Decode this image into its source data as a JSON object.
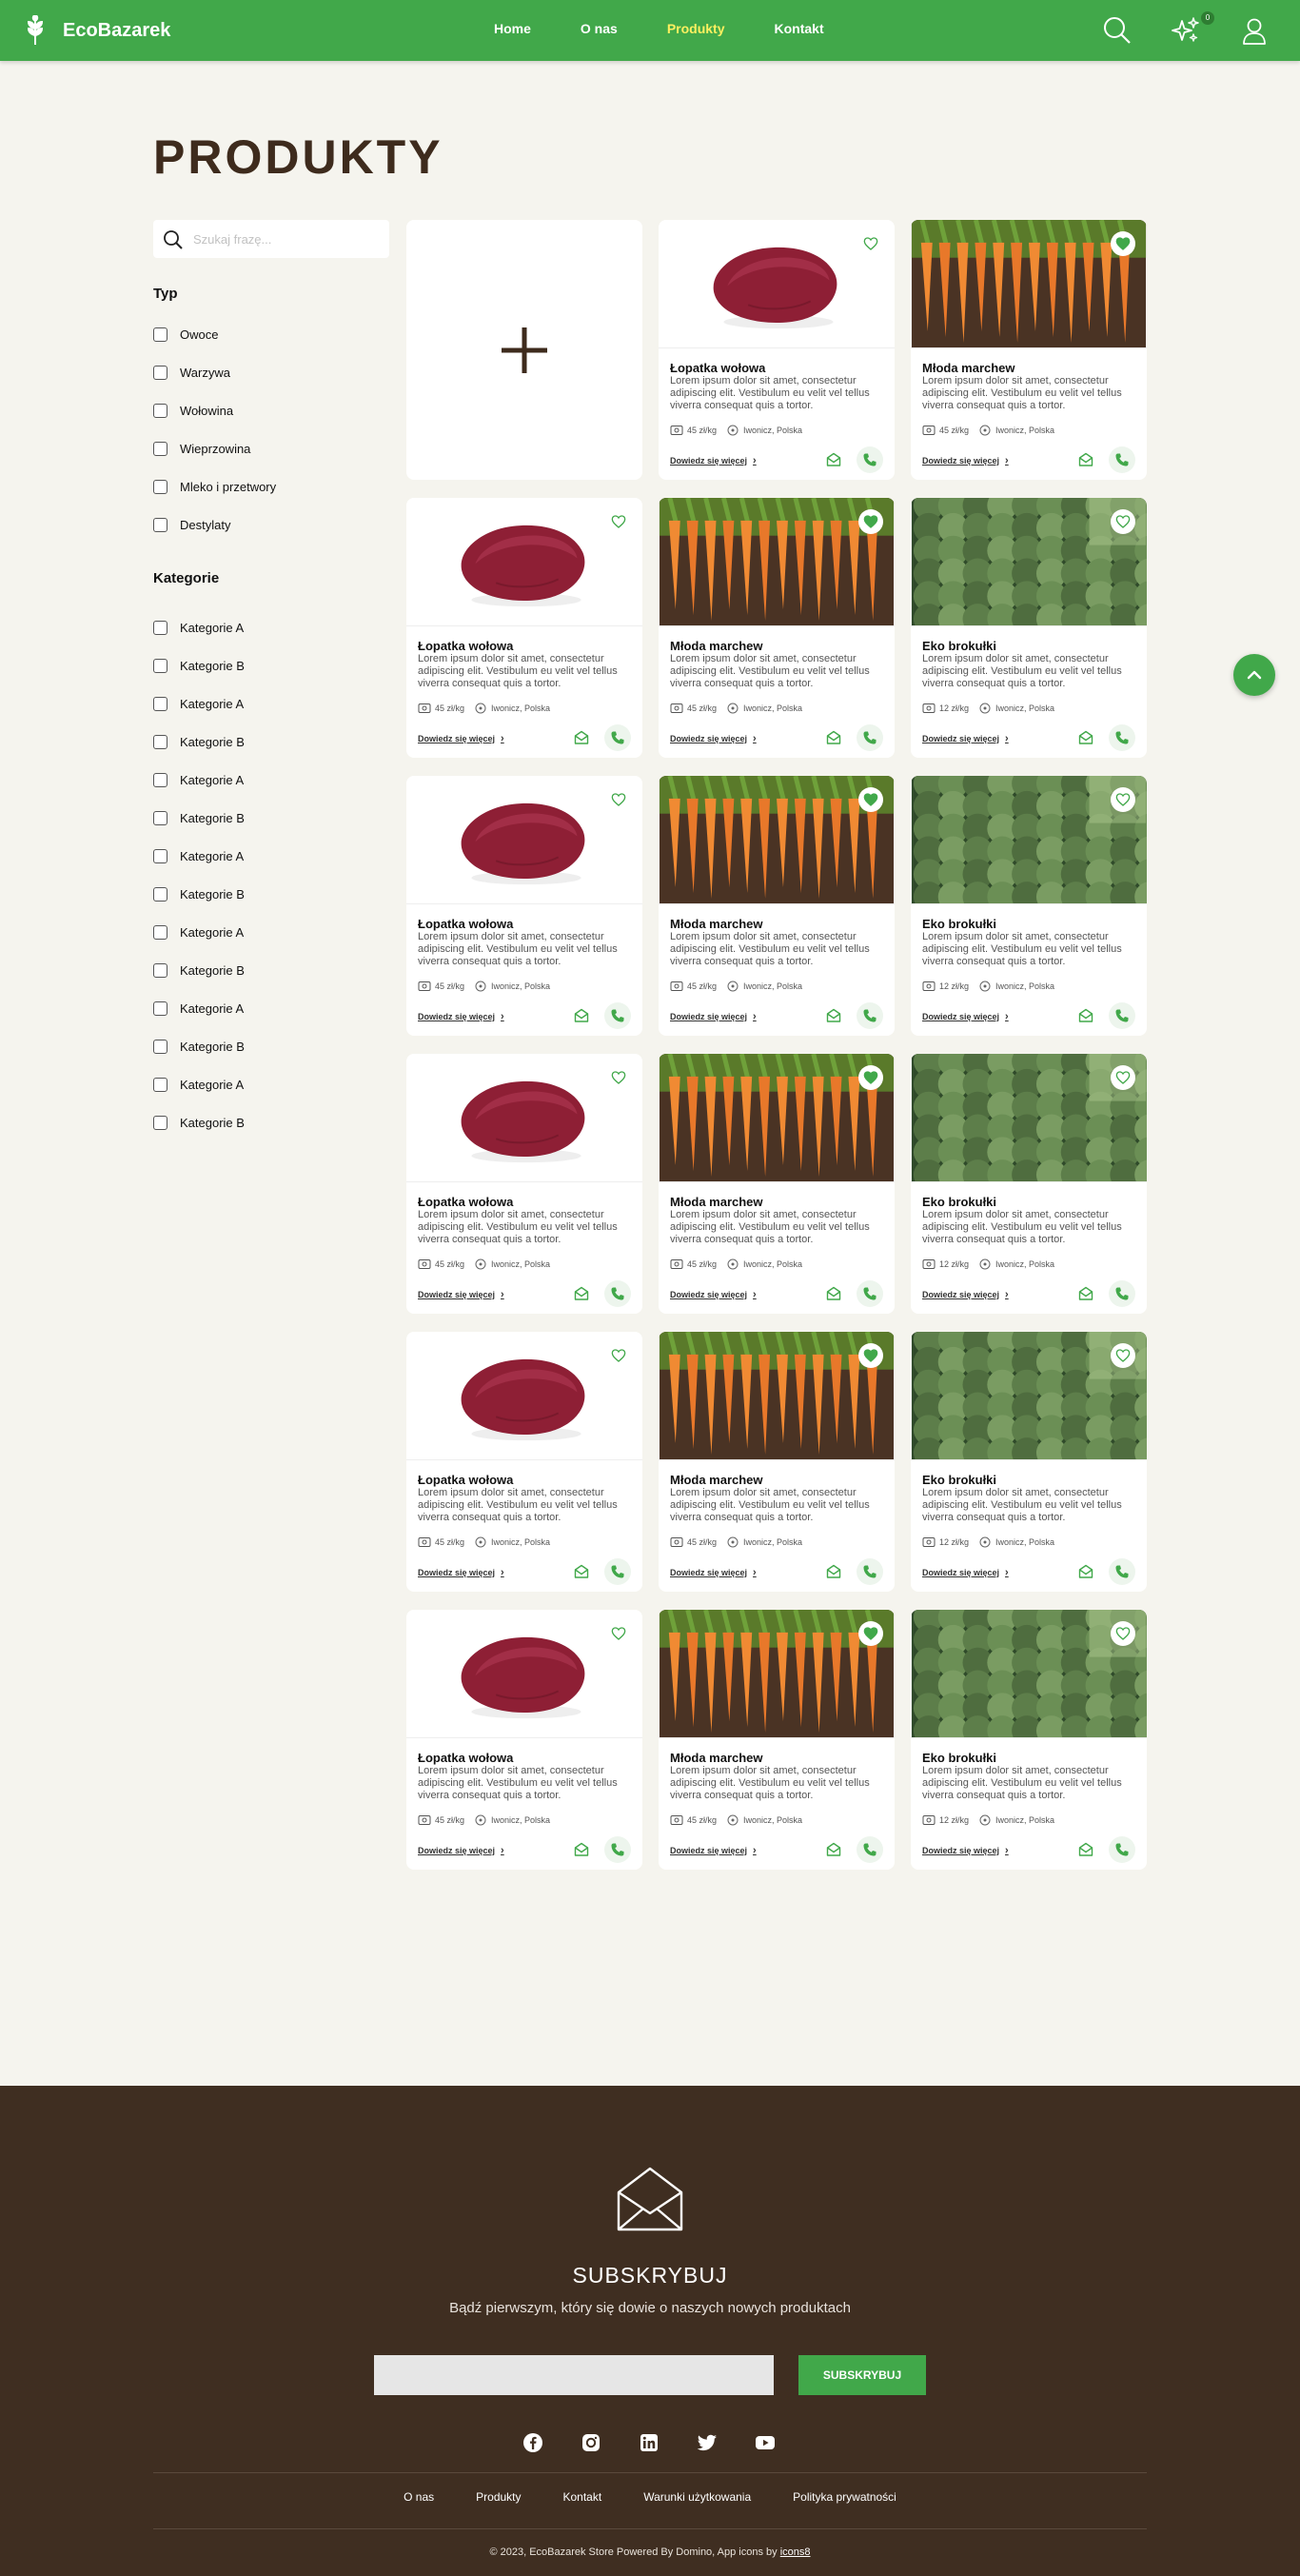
{
  "header": {
    "brand": "EcoBazarek",
    "nav": [
      "Home",
      "O nas",
      "Produkty",
      "Kontakt"
    ],
    "active_nav": "Produkty",
    "favorites_count": "0",
    "accent_color": "#41a84a",
    "icons": [
      "wheat-logo-icon",
      "search-icon",
      "sparkles-icon",
      "user-icon"
    ]
  },
  "page": {
    "title": "PRODUKTY"
  },
  "sidebar": {
    "search_placeholder": "Szukaj frazę...",
    "type_heading": "Typ",
    "types": [
      "Owoce",
      "Warzywa",
      "Wołowina",
      "Wieprzowina",
      "Mleko i przetwory",
      "Destylaty"
    ],
    "category_heading": "Kategorie",
    "categories": [
      "Kategorie A",
      "Kategorie B",
      "Kategorie A",
      "Kategorie B",
      "Kategorie A",
      "Kategorie B",
      "Kategorie A",
      "Kategorie B",
      "Kategorie A",
      "Kategorie B",
      "Kategorie A",
      "Kategorie B",
      "Kategorie A",
      "Kategorie B"
    ]
  },
  "products": {
    "description": "Lorem ipsum dolor sit amet, consectetur adipiscing elit. Vestibulum eu velit vel tellus viverra consequat quis a tortor.",
    "more_label": "Dowiedz się więcej",
    "location": "Iwonicz, Polska",
    "types": {
      "beef": {
        "title": "Łopatka wołowa",
        "price": "45 zł/kg"
      },
      "carrot": {
        "title": "Młoda marchew",
        "price": "45 zł/kg"
      },
      "broccoli": {
        "title": "Eko brokułki",
        "price": "12 zł/kg"
      }
    },
    "grid": [
      [
        "add",
        "beef",
        "carrot"
      ],
      [
        "beef",
        "carrot",
        "broccoli"
      ],
      [
        "beef",
        "carrot",
        "broccoli"
      ],
      [
        "beef",
        "carrot",
        "broccoli"
      ],
      [
        "beef",
        "carrot",
        "broccoli"
      ],
      [
        "beef",
        "carrot",
        "broccoli"
      ]
    ],
    "favorited": [
      [
        false,
        false,
        true
      ],
      [
        false,
        true,
        false
      ],
      [
        false,
        true,
        false
      ],
      [
        false,
        true,
        false
      ],
      [
        false,
        true,
        false
      ],
      [
        false,
        true,
        false
      ]
    ]
  },
  "footer": {
    "subscribe_title": "SUBSKRYBUJ",
    "subscribe_text": "Bądź pierwszym, który się dowie o naszych nowych produktach",
    "subscribe_button": "SUBSKRYBUJ",
    "socials": [
      "facebook-icon",
      "instagram-icon",
      "linkedin-icon",
      "twitter-icon",
      "youtube-icon"
    ],
    "links": [
      "O nas",
      "Produkty",
      "Kontakt",
      "Warunki użytkowania",
      "Polityka prywatności"
    ],
    "copyright_prefix": "© 2023, EcoBazarek Store Powered By Domino, App icons by ",
    "copyright_link": "icons8"
  }
}
